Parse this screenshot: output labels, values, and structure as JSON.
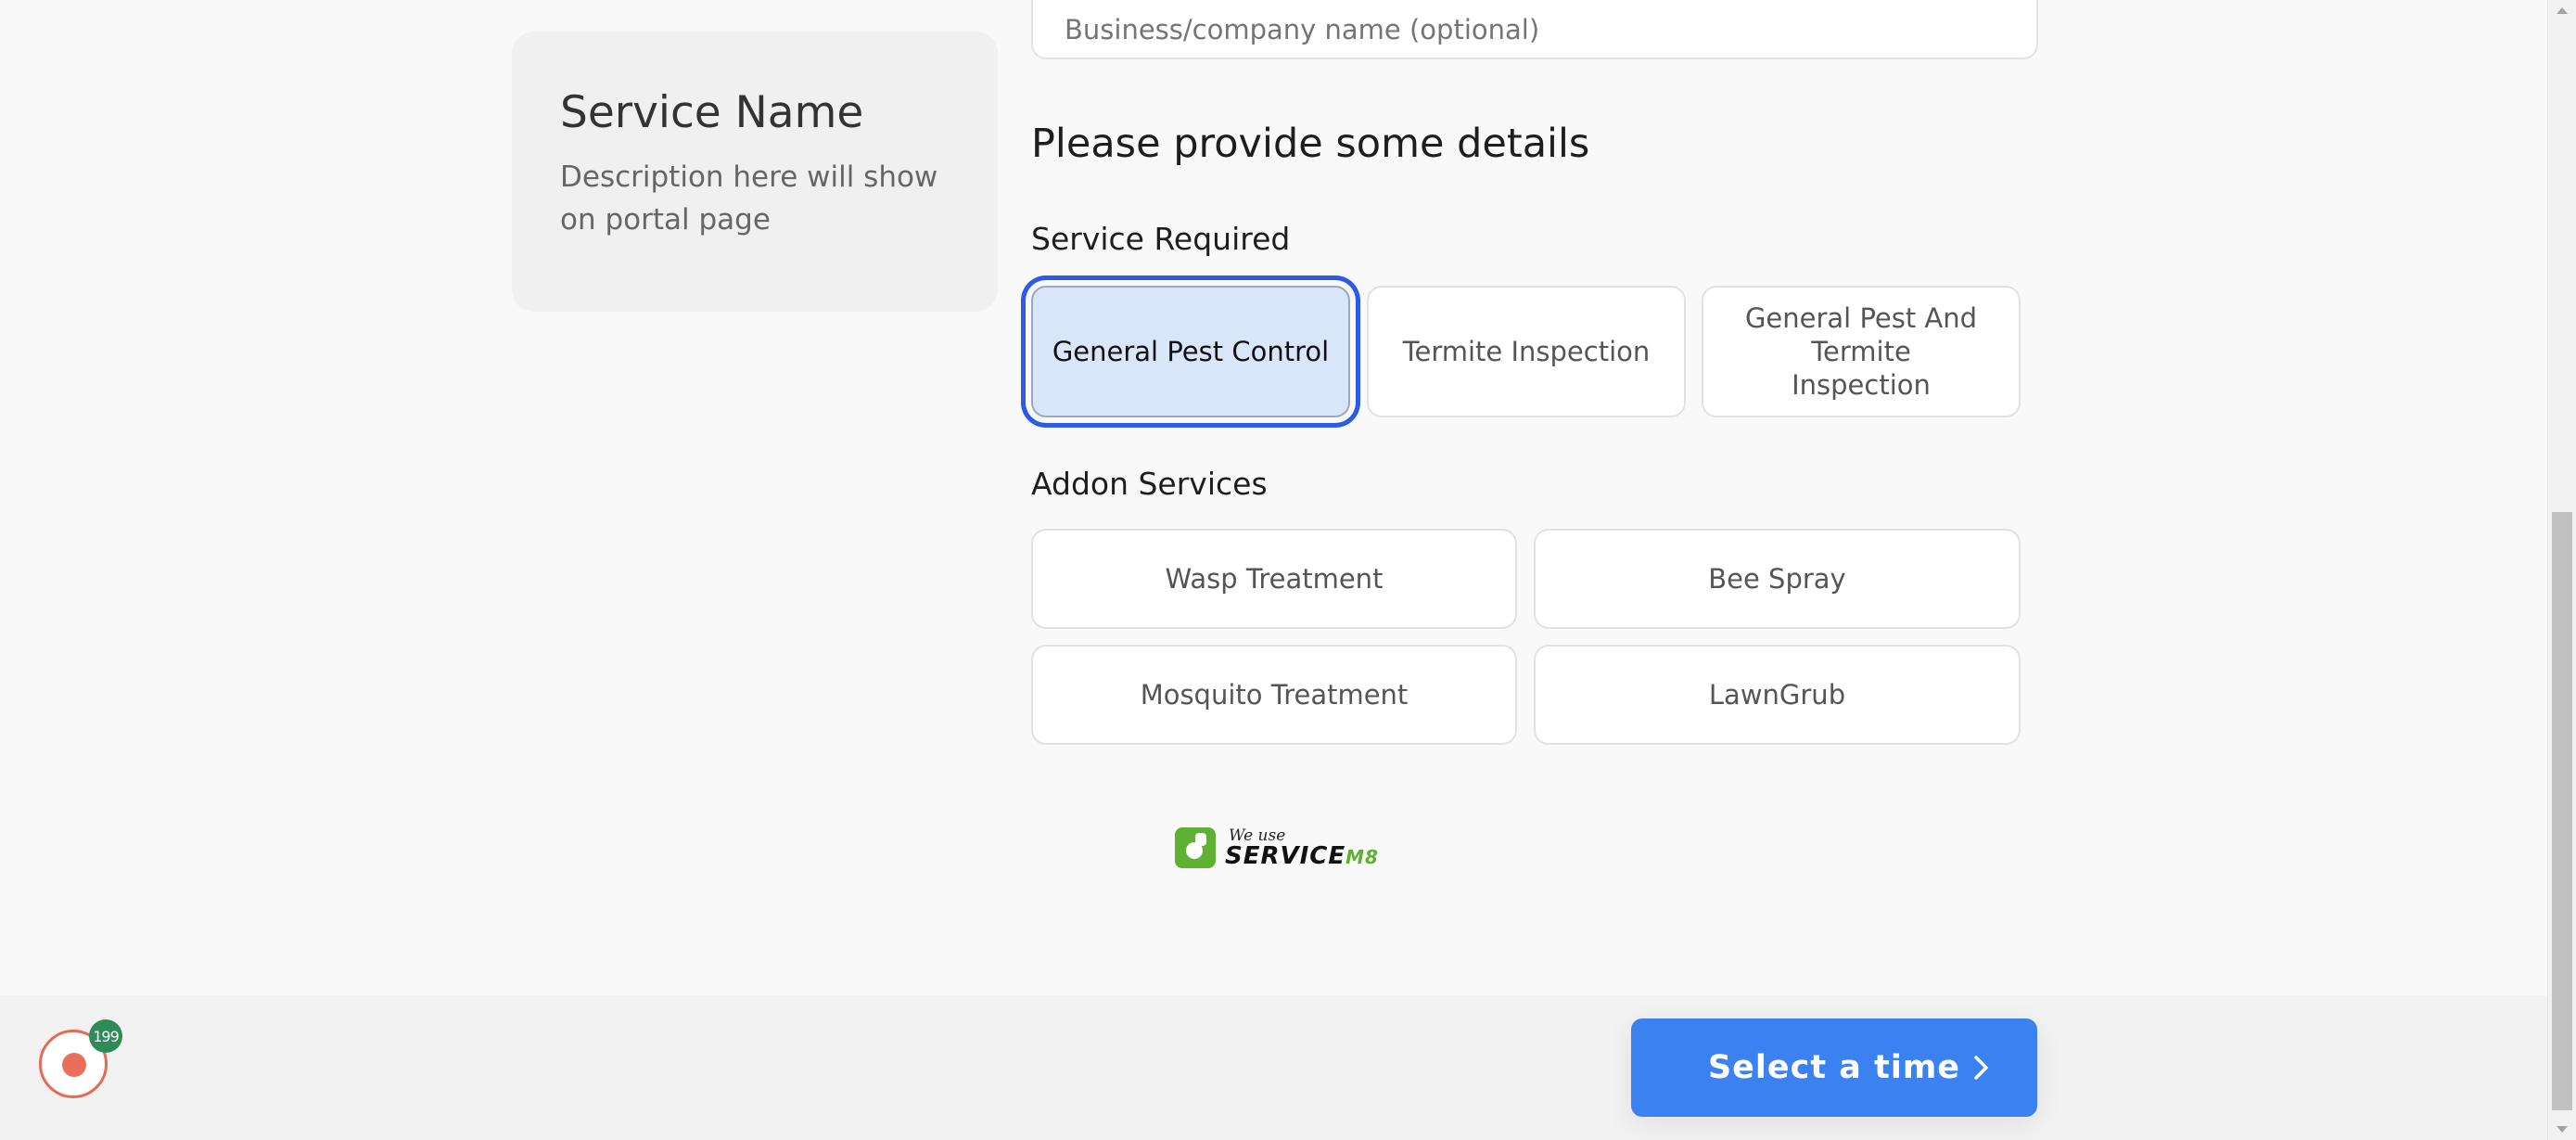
{
  "contact": {
    "business_placeholder": "Business/company name (optional)"
  },
  "service_card": {
    "title": "Service Name",
    "description": "Description here will show on portal page"
  },
  "details": {
    "heading": "Please provide some details",
    "service_required_label": "Service Required",
    "services": [
      {
        "label": "General Pest Control",
        "selected": true
      },
      {
        "label": "Termite Inspection",
        "selected": false
      },
      {
        "label": "General Pest And Termite Inspection",
        "selected": false
      }
    ],
    "addon_label": "Addon Services",
    "addons": [
      {
        "label": "Wasp Treatment"
      },
      {
        "label": "Bee Spray"
      },
      {
        "label": "Mosquito Treatment"
      },
      {
        "label": "LawnGrub"
      }
    ]
  },
  "branding": {
    "small_text": "We use",
    "brand_name": "SERVICE",
    "brand_suffix": "M8"
  },
  "footer": {
    "recorder_badge_count": "199",
    "cta_label": "Select a time",
    "cta_color": "#3b82f0"
  },
  "icons": {
    "cta": "chevron-right-icon",
    "recorder": "record-icon",
    "logo": "servicem8-logo-icon"
  }
}
